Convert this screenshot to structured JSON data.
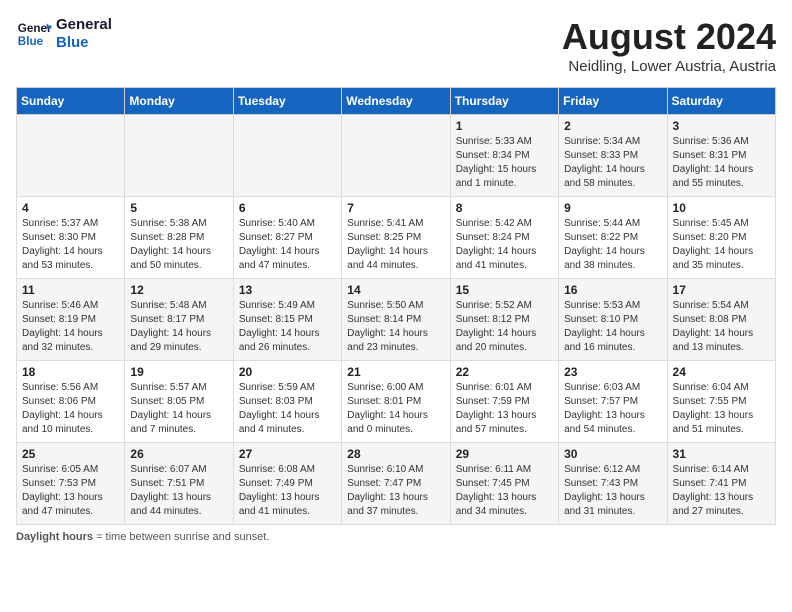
{
  "header": {
    "logo_line1": "General",
    "logo_line2": "Blue",
    "month_title": "August 2024",
    "subtitle": "Neidling, Lower Austria, Austria"
  },
  "days_of_week": [
    "Sunday",
    "Monday",
    "Tuesday",
    "Wednesday",
    "Thursday",
    "Friday",
    "Saturday"
  ],
  "footer": {
    "label": "Daylight hours"
  },
  "weeks": [
    [
      {
        "day": "",
        "content": ""
      },
      {
        "day": "",
        "content": ""
      },
      {
        "day": "",
        "content": ""
      },
      {
        "day": "",
        "content": ""
      },
      {
        "day": "1",
        "content": "Sunrise: 5:33 AM\nSunset: 8:34 PM\nDaylight: 15 hours\nand 1 minute."
      },
      {
        "day": "2",
        "content": "Sunrise: 5:34 AM\nSunset: 8:33 PM\nDaylight: 14 hours\nand 58 minutes."
      },
      {
        "day": "3",
        "content": "Sunrise: 5:36 AM\nSunset: 8:31 PM\nDaylight: 14 hours\nand 55 minutes."
      }
    ],
    [
      {
        "day": "4",
        "content": "Sunrise: 5:37 AM\nSunset: 8:30 PM\nDaylight: 14 hours\nand 53 minutes."
      },
      {
        "day": "5",
        "content": "Sunrise: 5:38 AM\nSunset: 8:28 PM\nDaylight: 14 hours\nand 50 minutes."
      },
      {
        "day": "6",
        "content": "Sunrise: 5:40 AM\nSunset: 8:27 PM\nDaylight: 14 hours\nand 47 minutes."
      },
      {
        "day": "7",
        "content": "Sunrise: 5:41 AM\nSunset: 8:25 PM\nDaylight: 14 hours\nand 44 minutes."
      },
      {
        "day": "8",
        "content": "Sunrise: 5:42 AM\nSunset: 8:24 PM\nDaylight: 14 hours\nand 41 minutes."
      },
      {
        "day": "9",
        "content": "Sunrise: 5:44 AM\nSunset: 8:22 PM\nDaylight: 14 hours\nand 38 minutes."
      },
      {
        "day": "10",
        "content": "Sunrise: 5:45 AM\nSunset: 8:20 PM\nDaylight: 14 hours\nand 35 minutes."
      }
    ],
    [
      {
        "day": "11",
        "content": "Sunrise: 5:46 AM\nSunset: 8:19 PM\nDaylight: 14 hours\nand 32 minutes."
      },
      {
        "day": "12",
        "content": "Sunrise: 5:48 AM\nSunset: 8:17 PM\nDaylight: 14 hours\nand 29 minutes."
      },
      {
        "day": "13",
        "content": "Sunrise: 5:49 AM\nSunset: 8:15 PM\nDaylight: 14 hours\nand 26 minutes."
      },
      {
        "day": "14",
        "content": "Sunrise: 5:50 AM\nSunset: 8:14 PM\nDaylight: 14 hours\nand 23 minutes."
      },
      {
        "day": "15",
        "content": "Sunrise: 5:52 AM\nSunset: 8:12 PM\nDaylight: 14 hours\nand 20 minutes."
      },
      {
        "day": "16",
        "content": "Sunrise: 5:53 AM\nSunset: 8:10 PM\nDaylight: 14 hours\nand 16 minutes."
      },
      {
        "day": "17",
        "content": "Sunrise: 5:54 AM\nSunset: 8:08 PM\nDaylight: 14 hours\nand 13 minutes."
      }
    ],
    [
      {
        "day": "18",
        "content": "Sunrise: 5:56 AM\nSunset: 8:06 PM\nDaylight: 14 hours\nand 10 minutes."
      },
      {
        "day": "19",
        "content": "Sunrise: 5:57 AM\nSunset: 8:05 PM\nDaylight: 14 hours\nand 7 minutes."
      },
      {
        "day": "20",
        "content": "Sunrise: 5:59 AM\nSunset: 8:03 PM\nDaylight: 14 hours\nand 4 minutes."
      },
      {
        "day": "21",
        "content": "Sunrise: 6:00 AM\nSunset: 8:01 PM\nDaylight: 14 hours\nand 0 minutes."
      },
      {
        "day": "22",
        "content": "Sunrise: 6:01 AM\nSunset: 7:59 PM\nDaylight: 13 hours\nand 57 minutes."
      },
      {
        "day": "23",
        "content": "Sunrise: 6:03 AM\nSunset: 7:57 PM\nDaylight: 13 hours\nand 54 minutes."
      },
      {
        "day": "24",
        "content": "Sunrise: 6:04 AM\nSunset: 7:55 PM\nDaylight: 13 hours\nand 51 minutes."
      }
    ],
    [
      {
        "day": "25",
        "content": "Sunrise: 6:05 AM\nSunset: 7:53 PM\nDaylight: 13 hours\nand 47 minutes."
      },
      {
        "day": "26",
        "content": "Sunrise: 6:07 AM\nSunset: 7:51 PM\nDaylight: 13 hours\nand 44 minutes."
      },
      {
        "day": "27",
        "content": "Sunrise: 6:08 AM\nSunset: 7:49 PM\nDaylight: 13 hours\nand 41 minutes."
      },
      {
        "day": "28",
        "content": "Sunrise: 6:10 AM\nSunset: 7:47 PM\nDaylight: 13 hours\nand 37 minutes."
      },
      {
        "day": "29",
        "content": "Sunrise: 6:11 AM\nSunset: 7:45 PM\nDaylight: 13 hours\nand 34 minutes."
      },
      {
        "day": "30",
        "content": "Sunrise: 6:12 AM\nSunset: 7:43 PM\nDaylight: 13 hours\nand 31 minutes."
      },
      {
        "day": "31",
        "content": "Sunrise: 6:14 AM\nSunset: 7:41 PM\nDaylight: 13 hours\nand 27 minutes."
      }
    ]
  ]
}
